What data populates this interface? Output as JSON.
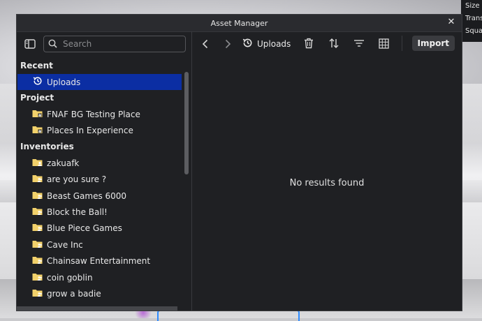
{
  "window": {
    "title": "Asset Manager"
  },
  "background": {
    "properties_panel": [
      "Size",
      "Trans",
      "Squa"
    ]
  },
  "search": {
    "placeholder": "Search"
  },
  "tree": {
    "recent_label": "Recent",
    "recent_items": [
      {
        "label": "Uploads",
        "icon": "history-icon",
        "selected": true
      }
    ],
    "project_label": "Project",
    "project_items": [
      {
        "label": "FNAF BG Testing Place",
        "icon": "folder-place-icon"
      },
      {
        "label": "Places In Experience",
        "icon": "folder-place-icon"
      }
    ],
    "inventories_label": "Inventories",
    "inventory_items": [
      {
        "label": "zakuafk",
        "icon": "folder-user-icon"
      },
      {
        "label": "are you sure ?",
        "icon": "folder-group-icon"
      },
      {
        "label": "Beast Games 6000",
        "icon": "folder-group-icon"
      },
      {
        "label": "Block the Ball!",
        "icon": "folder-group-icon"
      },
      {
        "label": "Blue Piece Games",
        "icon": "folder-group-icon"
      },
      {
        "label": "Cave Inc",
        "icon": "folder-group-icon"
      },
      {
        "label": "Chainsaw Entertainment",
        "icon": "folder-group-icon"
      },
      {
        "label": "coin goblin",
        "icon": "folder-group-icon"
      },
      {
        "label": "grow a badie",
        "icon": "folder-group-icon"
      }
    ]
  },
  "breadcrumb": {
    "current": "Uploads"
  },
  "toolbar": {
    "import_label": "Import"
  },
  "content": {
    "empty_message": "No results found"
  },
  "colors": {
    "accent_selected": "#0b2ea3",
    "folder": "#f2d16b",
    "panel_bg": "#1f2023"
  }
}
